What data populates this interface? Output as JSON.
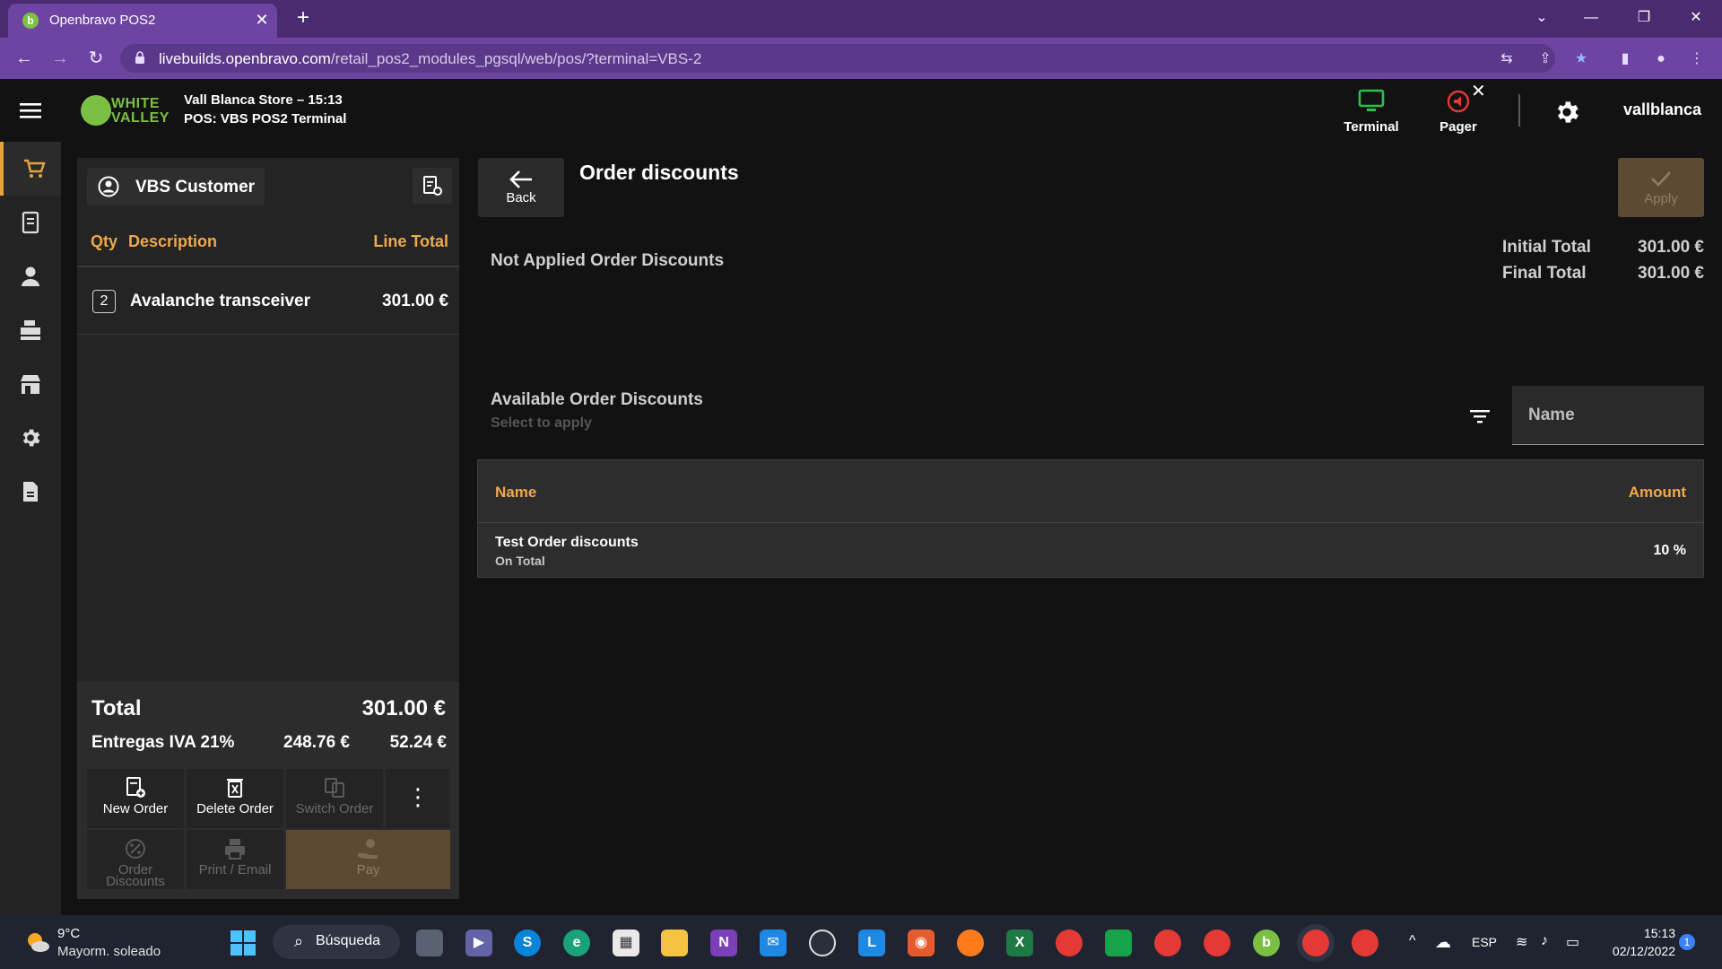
{
  "browser": {
    "tab_title": "Openbravo POS2",
    "url_host": "livebuilds.openbravo.com",
    "url_path": "/retail_pos2_modules_pgsql/web/pos/?terminal=VBS-2"
  },
  "header": {
    "logo_text_1": "WHITE",
    "logo_text_2": "VALLEY",
    "store_line": "Vall Blanca Store – 15:13",
    "pos_line": "POS: VBS POS2 Terminal",
    "terminal_label": "Terminal",
    "pager_label": "Pager",
    "user": "vallblanca",
    "colors": {
      "terminal": "#27c24c",
      "pager": "#e53935",
      "accent": "#f0a84a"
    }
  },
  "nav": [
    "cart-icon",
    "receipt-icon",
    "person-icon",
    "cash-register-icon",
    "store-icon",
    "gear-icon",
    "document-icon"
  ],
  "ticket": {
    "customer": "VBS Customer",
    "col_qty": "Qty",
    "col_desc": "Description",
    "col_total": "Line Total",
    "lines": [
      {
        "qty": "2",
        "description": "Avalanche transceiver",
        "total": "301.00 €"
      }
    ],
    "total_label": "Total",
    "total_value": "301.00 €",
    "tax_name": "Entregas IVA 21%",
    "tax_base": "248.76 €",
    "tax_amount": "52.24 €",
    "actions": {
      "new_order": "New Order",
      "delete_order": "Delete Order",
      "switch_order": "Switch Order",
      "order_discounts_1": "Order",
      "order_discounts_2": "Discounts",
      "print_email": "Print / Email",
      "pay": "Pay"
    }
  },
  "main": {
    "back_label": "Back",
    "title": "Order discounts",
    "apply_label": "Apply",
    "initial_total_label": "Initial Total",
    "initial_total_value": "301.00 €",
    "final_total_label": "Final Total",
    "final_total_value": "301.00 €",
    "not_applied_title": "Not Applied Order Discounts",
    "available_title": "Available Order Discounts",
    "available_subtitle": "Select to apply",
    "name_placeholder": "Name",
    "table": {
      "col_name": "Name",
      "col_amount": "Amount",
      "rows": [
        {
          "name": "Test Order discounts",
          "type": "On Total",
          "amount": "10 %"
        }
      ]
    }
  },
  "taskbar": {
    "weather_temp": "9°C",
    "weather_desc": "Mayorm. soleado",
    "search_label": "Búsqueda",
    "lang": "ESP",
    "time": "15:13",
    "date": "02/12/2022",
    "notifications": "1"
  }
}
